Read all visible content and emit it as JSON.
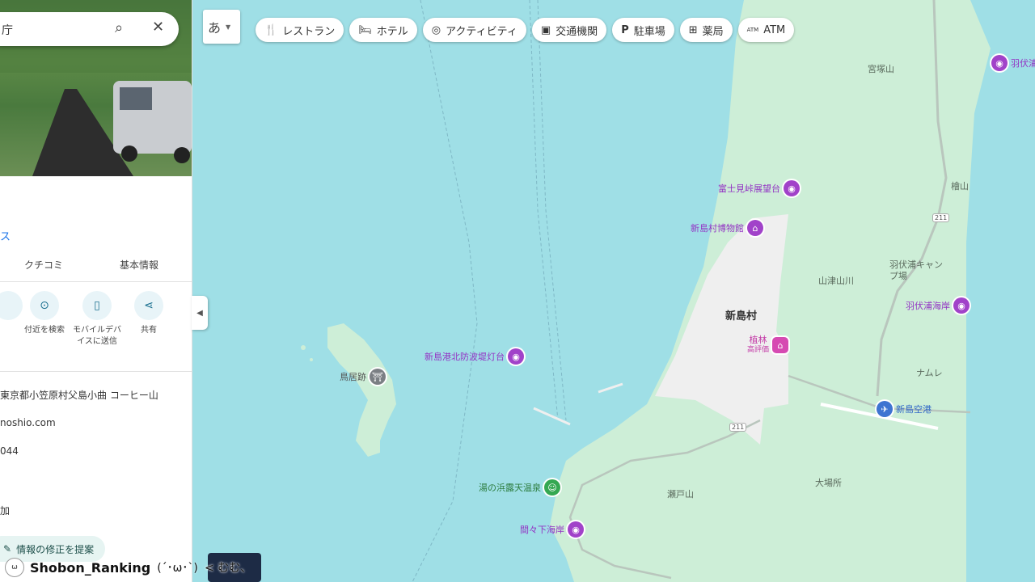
{
  "colors": {
    "water": "#9fdfe6",
    "land": "#cdeed7",
    "town": "#efefef",
    "poi_purple": "#a142c9"
  },
  "search": {
    "query": "庁"
  },
  "panel": {
    "link_fragment": "ス",
    "tabs": [
      "クチコミ",
      "基本情報"
    ],
    "actions": [
      {
        "icon": "nearby-icon",
        "label": "付近を検索"
      },
      {
        "icon": "mobile-icon",
        "label": "モバイルデバイスに送信"
      },
      {
        "icon": "share-icon",
        "label": "共有"
      }
    ],
    "info": {
      "address": "東京都小笠原村父島小曲 コーヒー山",
      "website": "noshio.com",
      "phone": "044",
      "add": "加"
    },
    "suggest_edit": "情報の修正を提案"
  },
  "lang_button": "あ",
  "chips": [
    {
      "icon": "restaurant-icon",
      "label": "レストラン"
    },
    {
      "icon": "hotel-icon",
      "label": "ホテル"
    },
    {
      "icon": "camera-icon",
      "label": "アクティビティ"
    },
    {
      "icon": "train-icon",
      "label": "交通機関"
    },
    {
      "icon": "parking-icon",
      "label": "駐車場"
    },
    {
      "icon": "pharmacy-icon",
      "label": "薬局"
    },
    {
      "icon": "atm-icon",
      "label": "ATM"
    }
  ],
  "map": {
    "pois": [
      {
        "label": "富士見峠展望台",
        "type": "purple"
      },
      {
        "label": "新島村博物館",
        "type": "purple"
      },
      {
        "label": "新島港北防波堤灯台",
        "type": "purple"
      },
      {
        "label": "鳥居跡",
        "type": "gray"
      },
      {
        "label": "湯の浜露天温泉",
        "type": "green"
      },
      {
        "label": "間々下海岸",
        "type": "purple"
      },
      {
        "label": "新島空港",
        "type": "blue"
      },
      {
        "label": "羽伏浦海岸",
        "type": "purple"
      },
      {
        "label": "羽伏浦",
        "type": "purple"
      },
      {
        "label": "植林",
        "sub": "高評価",
        "type": "pink"
      }
    ],
    "places": {
      "town": "新島村",
      "miyatsukayama": "宮塚山",
      "hinokiyama": "檜山",
      "yamatsuyama": "山津山川",
      "habushi_camp": "羽伏浦キャンプ場",
      "namure": "ナムレ",
      "setoyama": "瀬戸山",
      "obasho": "大場所"
    },
    "route_numbers": [
      "211",
      "211"
    ]
  },
  "overlay": {
    "avatar": "ω",
    "name": "Shobon_Ranking",
    "face": "(´･ω･`)",
    "speech": "< むむ、"
  }
}
